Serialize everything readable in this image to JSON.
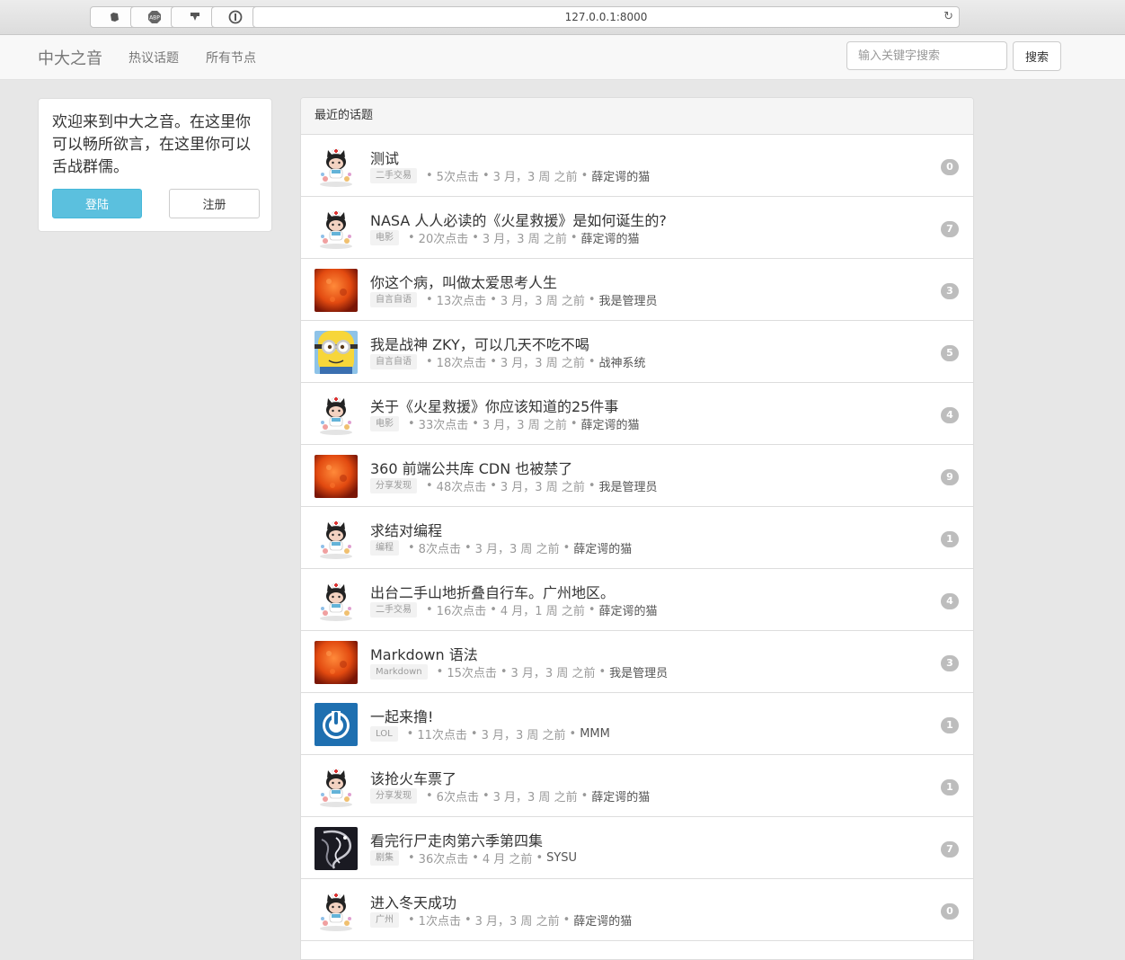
{
  "browser": {
    "url": "127.0.0.1:8000",
    "extensions": [
      "evernote-icon",
      "adblock-icon",
      "download-icon",
      "onepassword-icon"
    ]
  },
  "navbar": {
    "brand": "中大之音",
    "links": [
      "热议话题",
      "所有节点"
    ],
    "search_placeholder": "输入关键字搜索",
    "search_button": "搜索"
  },
  "welcome": {
    "text": "欢迎来到中大之音。在这里你可以畅所欲言，在这里你可以舌战群儒。",
    "login": "登陆",
    "register": "注册",
    "login_color": "#5bc0de"
  },
  "topics": {
    "heading": "最近的话题",
    "items": [
      {
        "title": "测试",
        "node": "二手交易",
        "clicks": "5次点击",
        "time": "3 月，3 周 之前",
        "author": "薛定谔的猫",
        "replies": "0",
        "avatar": "octocat"
      },
      {
        "title": "NASA 人人必读的《火星救援》是如何诞生的?",
        "node": "电影",
        "clicks": "20次点击",
        "time": "3 月，3 周 之前",
        "author": "薛定谔的猫",
        "replies": "7",
        "avatar": "octocat"
      },
      {
        "title": "你这个病，叫做太爱思考人生",
        "node": "自言自语",
        "clicks": "13次点击",
        "time": "3 月，3 周 之前",
        "author": "我是管理员",
        "replies": "3",
        "avatar": "sun"
      },
      {
        "title": "我是战神 ZKY，可以几天不吃不喝",
        "node": "自言自语",
        "clicks": "18次点击",
        "time": "3 月，3 周 之前",
        "author": "战神系统",
        "replies": "5",
        "avatar": "minion"
      },
      {
        "title": "关于《火星救援》你应该知道的25件事",
        "node": "电影",
        "clicks": "33次点击",
        "time": "3 月，3 周 之前",
        "author": "薛定谔的猫",
        "replies": "4",
        "avatar": "octocat"
      },
      {
        "title": "360 前端公共库 CDN 也被禁了",
        "node": "分享发现",
        "clicks": "48次点击",
        "time": "3 月，3 周 之前",
        "author": "我是管理员",
        "replies": "9",
        "avatar": "sun"
      },
      {
        "title": "求结对编程",
        "node": "编程",
        "clicks": "8次点击",
        "time": "3 月，3 周 之前",
        "author": "薛定谔的猫",
        "replies": "1",
        "avatar": "octocat"
      },
      {
        "title": "出台二手山地折叠自行车。广州地区。",
        "node": "二手交易",
        "clicks": "16次点击",
        "time": "4 月，1 周 之前",
        "author": "薛定谔的猫",
        "replies": "4",
        "avatar": "octocat"
      },
      {
        "title": "Markdown 语法",
        "node": "Markdown",
        "clicks": "15次点击",
        "time": "3 月，3 周 之前",
        "author": "我是管理员",
        "replies": "3",
        "avatar": "sun"
      },
      {
        "title": "一起来撸!",
        "node": "LOL",
        "clicks": "11次点击",
        "time": "3 月，3 周 之前",
        "author": "MMM",
        "replies": "1",
        "avatar": "power"
      },
      {
        "title": "该抢火车票了",
        "node": "分享发现",
        "clicks": "6次点击",
        "time": "3 月，3 周 之前",
        "author": "薛定谔的猫",
        "replies": "1",
        "avatar": "octocat"
      },
      {
        "title": "看完行尸走肉第六季第四集",
        "node": "剧集",
        "clicks": "36次点击",
        "time": "4 月 之前",
        "author": "SYSU",
        "replies": "7",
        "avatar": "dragon"
      },
      {
        "title": "进入冬天成功",
        "node": "广州",
        "clicks": "1次点击",
        "time": "3 月，3 周 之前",
        "author": "薛定谔的猫",
        "replies": "0",
        "avatar": "octocat"
      }
    ]
  }
}
